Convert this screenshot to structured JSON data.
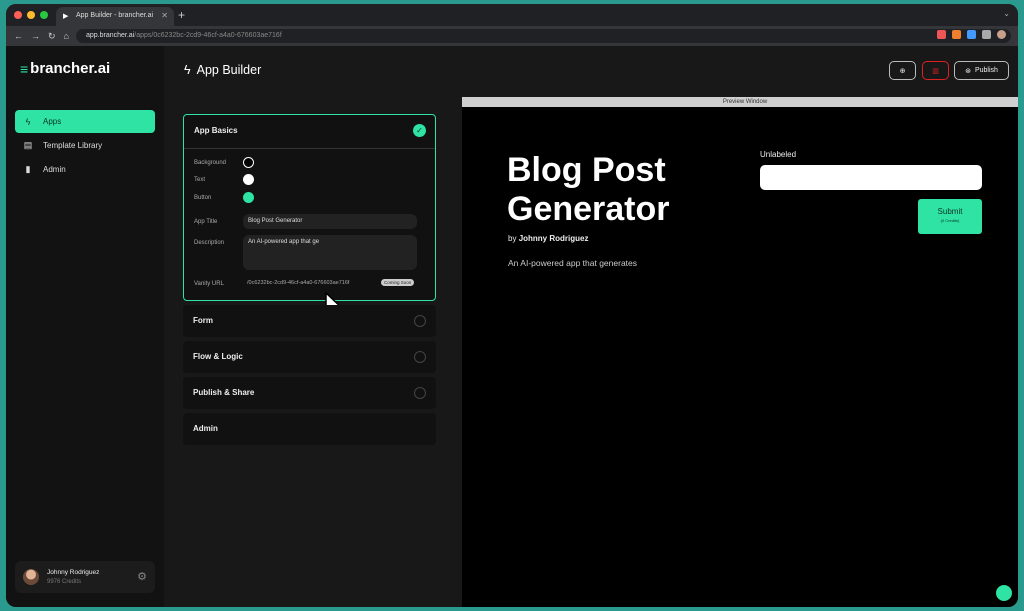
{
  "browser": {
    "tab_title": "App Builder - brancher.ai",
    "url_host": "app.brancher.ai",
    "url_path": "/apps/0c6232bc-2cd9-46cf-a4a0-676603ae716f",
    "colors": {
      "close": "#ff5f57",
      "min": "#febc2e",
      "max": "#28c840"
    }
  },
  "sidebar": {
    "logo": "brancher.ai",
    "items": [
      {
        "label": "Apps",
        "icon": "bolt-icon"
      },
      {
        "label": "Template Library",
        "icon": "library-icon"
      },
      {
        "label": "Admin",
        "icon": "chart-icon"
      }
    ],
    "user": {
      "name": "Johnny Rodriguez",
      "credits": "9976 Credits"
    }
  },
  "header": {
    "title": "App Builder",
    "publish_label": "Publish"
  },
  "panel": {
    "sections": [
      {
        "title": "App Basics",
        "complete": true
      },
      {
        "title": "Form",
        "complete": false
      },
      {
        "title": "Flow & Logic",
        "complete": false
      },
      {
        "title": "Publish & Share",
        "complete": false
      },
      {
        "title": "Admin",
        "complete": false
      }
    ],
    "basics": {
      "background_label": "Background",
      "text_label": "Text",
      "button_label": "Button",
      "app_title_label": "App Title",
      "app_title_value": "Blog Post Generator",
      "description_label": "Description",
      "description_value": "An AI-powered app that ge",
      "vanity_label": "Vanity URL",
      "vanity_value": "/0c6232bc-2cd9-46cf-a4a0-676603ae716f",
      "coming_soon": "Coming Soon"
    },
    "colors": {
      "background": "#000000",
      "text": "#ffffff",
      "button": "#2ee3a4"
    }
  },
  "preview": {
    "label": "Preview Window",
    "app_title": "Blog Post Generator",
    "by_prefix": "by",
    "author": "Johnny Rodriguez",
    "description": "An AI-powered app that generates",
    "field_label": "Unlabeled",
    "submit_label": "Submit",
    "submit_sub": "(0 Credits)"
  },
  "accent": "#2ee3a4"
}
